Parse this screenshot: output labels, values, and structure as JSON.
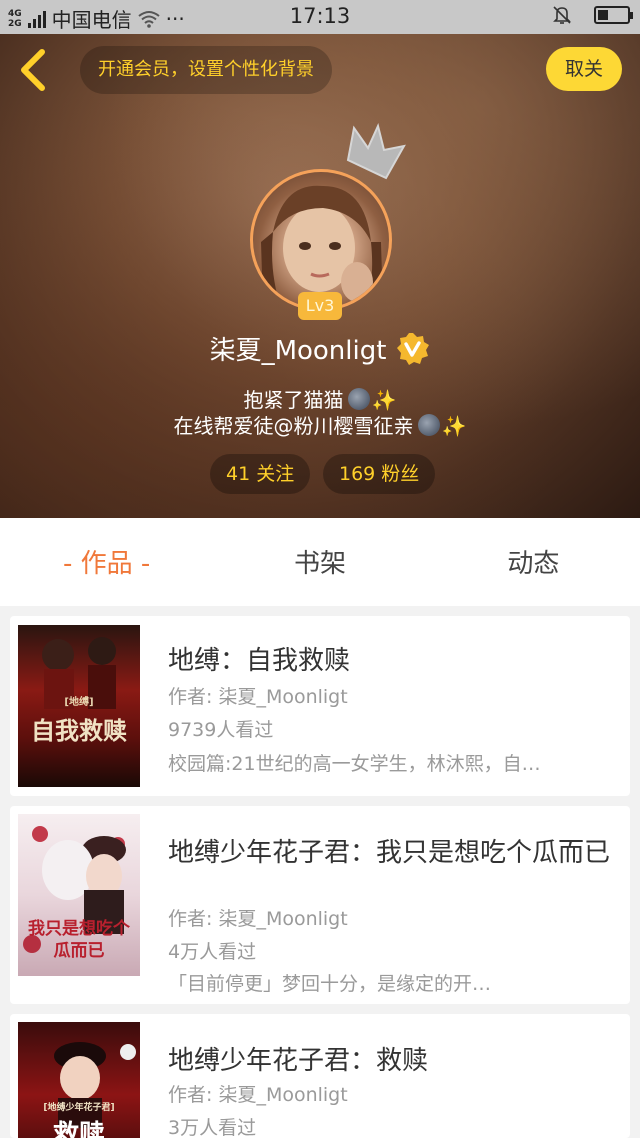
{
  "status_bar": {
    "network_top": "4G",
    "network_bottom": "2G",
    "carrier": "中国电信",
    "more": "···",
    "time": "17:13"
  },
  "header": {
    "member_banner": "开通会员，设置个性化背景",
    "unfollow_label": "取关",
    "level": "Lv3",
    "username": "柒夏_Moonligt",
    "bio_line1": "抱紧了猫猫",
    "bio_line2": "在线帮爱徒@粉川樱雪征亲",
    "sparkle": "✨",
    "following": "41 关注",
    "fans": "169 粉丝"
  },
  "tabs": [
    {
      "label": "- 作品 -",
      "active": true
    },
    {
      "label": "书架",
      "active": false
    },
    {
      "label": "动态",
      "active": false
    }
  ],
  "books": [
    {
      "cover_text": "自我救赎",
      "cover_small": "[地缚]",
      "title": "地缚：自我救赎",
      "author": "作者: 柒夏_Moonligt",
      "views": "9739人看过",
      "summary": "校园篇:21世纪的高一女学生，林沐熙，自…"
    },
    {
      "cover_text": "我只是想吃个瓜而已",
      "title": "地缚少年花子君：我只是想吃个瓜而已",
      "author": "作者: 柒夏_Moonligt",
      "views": "4万人看过",
      "summary": "「目前停更」梦回十分，是缘定的开…"
    },
    {
      "cover_text": "救赎",
      "cover_small": "[地缚少年花子君]",
      "title": "地缚少年花子君：救赎",
      "author": "作者: 柒夏_Moonligt",
      "views": "3万人看过"
    }
  ],
  "colors": {
    "accent_orange": "#f0783a",
    "gold": "#ffd02a",
    "yellow_button": "#fdd835"
  }
}
